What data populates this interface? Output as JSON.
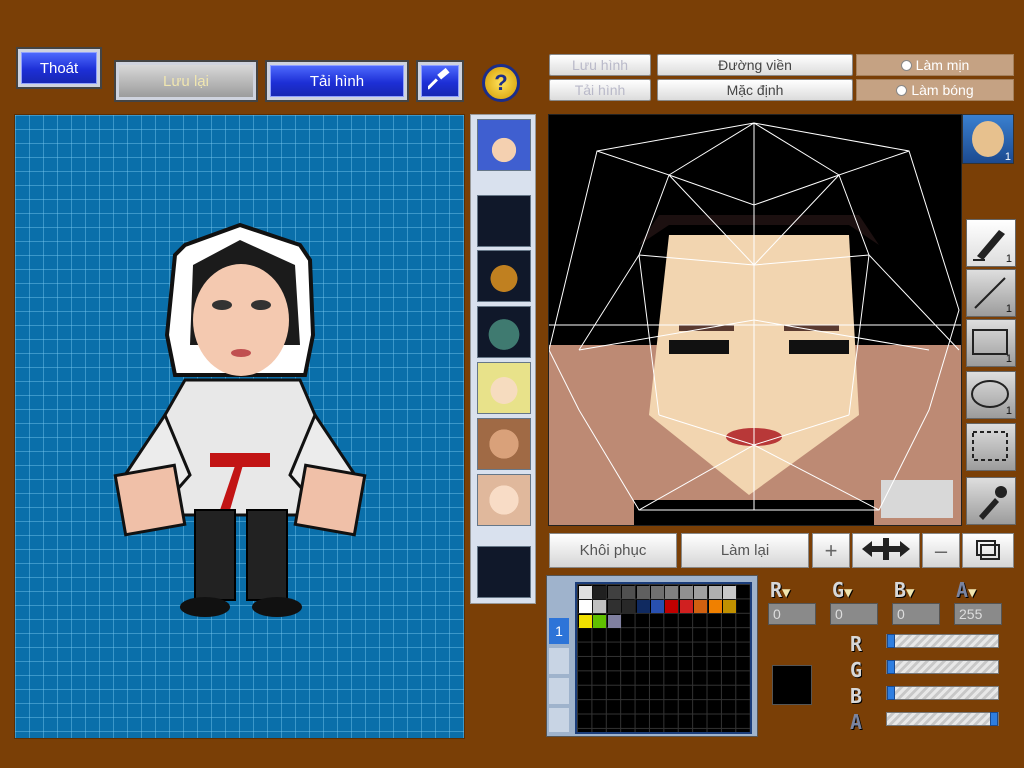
{
  "top_buttons": {
    "exit": "Thoát",
    "save": "Lưu lại",
    "reload": "Tải hình"
  },
  "editor": {
    "save_image": "Lưu hình",
    "load_image": "Tải hình",
    "outline": "Đường viền",
    "default": "Mặc định",
    "smooth": "Làm mịn",
    "shine": "Làm bóng",
    "restore": "Khôi phục",
    "redo": "Làm lại"
  },
  "tool_counts": {
    "face_badge": "1",
    "pen": "1",
    "line": "1",
    "rect": "1",
    "ellipse": "1"
  },
  "rgba": {
    "labels": [
      "R",
      "G",
      "B",
      "A"
    ],
    "values": {
      "r": "0",
      "g": "0",
      "b": "0",
      "a": "255"
    },
    "levels": {
      "r": 0,
      "g": 0,
      "b": 0,
      "a": 1.0
    }
  },
  "palette_tab": "1",
  "colors": {
    "background": "#7a3f06",
    "canvas": "#0a6faa",
    "selected_color": "#000000",
    "accent_blue": "#1d2fd6"
  },
  "palette_colors": [
    "#e0e0e0",
    "#202020",
    "#404040",
    "#505050",
    "#606060",
    "#707070",
    "#808080",
    "#909090",
    "#a0a0a0",
    "#b0b0b0",
    "#c8c8c8",
    "#ffffff",
    "#c0c0c0",
    "#303030",
    "#282828",
    "#102a60",
    "#2850b0",
    "#c00000",
    "#d02020",
    "#d06010",
    "#f08000",
    "#c09000",
    "#f0e000",
    "#60c000",
    "#8080a0"
  ]
}
